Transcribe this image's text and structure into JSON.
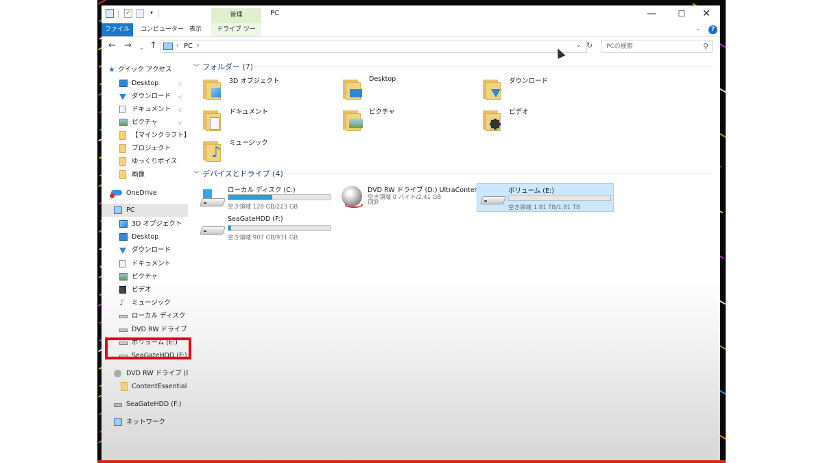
{
  "window": {
    "title": "PC",
    "management_tab": "管理",
    "controls": {
      "minimize": "—",
      "maximize": "☐",
      "close": "✕"
    },
    "qat_dropdown": "▾"
  },
  "ribbon": {
    "tabs": {
      "file": "ファイル",
      "computer": "コンピューター",
      "view": "表示",
      "drive_tools": "ドライブ ツール"
    },
    "chevron": "⌄",
    "help": "?"
  },
  "address_bar": {
    "back": "←",
    "forward": "→",
    "recent": "⌄",
    "up": "↑",
    "location": "PC",
    "separator": "›",
    "dropdown": "⌄",
    "refresh": "↻",
    "search_placeholder": "PCの検索",
    "search_glyph": "⚲"
  },
  "nav": {
    "quick_access": "クイック アクセス",
    "quick_items": [
      {
        "label": "Desktop",
        "icon": "desktop-icon",
        "pinned": true
      },
      {
        "label": "ダウンロード",
        "icon": "download-icon",
        "pinned": true
      },
      {
        "label": "ドキュメント",
        "icon": "document-icon",
        "pinned": true
      },
      {
        "label": "ピクチャ",
        "icon": "picture-icon",
        "pinned": true
      },
      {
        "label": "【マインクラフト】みずよ",
        "icon": "folder-icon",
        "pinned": false
      },
      {
        "label": "プロジェクト",
        "icon": "folder-icon",
        "pinned": false
      },
      {
        "label": "ゆっくりボイス",
        "icon": "folder-icon",
        "pinned": false
      },
      {
        "label": "画像",
        "icon": "folder-icon",
        "pinned": false
      }
    ],
    "pin_glyph": "📌",
    "onedrive": "OneDrive",
    "pc": "PC",
    "pc_items": [
      {
        "label": "3D オブジェクト",
        "icon": "3d-objects-icon"
      },
      {
        "label": "Desktop",
        "icon": "desktop-icon"
      },
      {
        "label": "ダウンロード",
        "icon": "download-icon"
      },
      {
        "label": "ドキュメント",
        "icon": "document-icon"
      },
      {
        "label": "ピクチャ",
        "icon": "picture-icon"
      },
      {
        "label": "ビデオ",
        "icon": "video-icon"
      },
      {
        "label": "ミュージック",
        "icon": "music-icon"
      },
      {
        "label": "ローカル ディスク (C:)",
        "icon": "drive-icon"
      },
      {
        "label": "DVD RW ドライブ (D:)",
        "icon": "dvd-icon"
      },
      {
        "label": "ボリューム (E:)",
        "icon": "drive-icon"
      },
      {
        "label": "SeaGateHDD (F:)",
        "icon": "drive-icon"
      }
    ],
    "dvd_root": "DVD RW ドライブ (D:) U",
    "dvd_child": "ContentEssential",
    "seagate_root": "SeaGateHDD (F:)",
    "network": "ネットワーク"
  },
  "content": {
    "folders_header": "フォルダー (7)",
    "folders": [
      {
        "label": "3D オブジェクト",
        "icon": "3d-objects-folder-icon"
      },
      {
        "label": "Desktop",
        "icon": "desktop-folder-icon"
      },
      {
        "label": "ダウンロード",
        "icon": "download-folder-icon"
      },
      {
        "label": "ドキュメント",
        "icon": "document-folder-icon"
      },
      {
        "label": "ピクチャ",
        "icon": "picture-folder-icon"
      },
      {
        "label": "ビデオ",
        "icon": "video-folder-icon"
      },
      {
        "label": "ミュージック",
        "icon": "music-folder-icon"
      }
    ],
    "devices_header": "デバイスとドライブ (4)",
    "drives": [
      {
        "name": "ローカル ディスク (C:)",
        "free": "空き領域 128 GB/223 GB",
        "used_fraction": 0.43,
        "icon": "windows-drive-icon",
        "selected": false
      },
      {
        "name": "DVD RW ドライブ (D:) UltraContents",
        "free": "空き領域 0 バイト/2.41 GB",
        "fs": "UDF",
        "icon": "dvd-drive-icon",
        "selected": false
      },
      {
        "name": "ボリューム (E:)",
        "free": "空き領域 1.81 TB/1.81 TB",
        "used_fraction": 0.0,
        "icon": "hdd-icon",
        "selected": true
      },
      {
        "name": "SeaGateHDD (F:)",
        "free": "空き領域 907 GB/931 GB",
        "used_fraction": 0.03,
        "icon": "hdd-icon",
        "selected": false
      }
    ]
  },
  "colors": {
    "accent": "#1979ca",
    "usage_bar": "#26a0da",
    "selection": "#cce8ff",
    "highlight_box": "#e4000f"
  }
}
